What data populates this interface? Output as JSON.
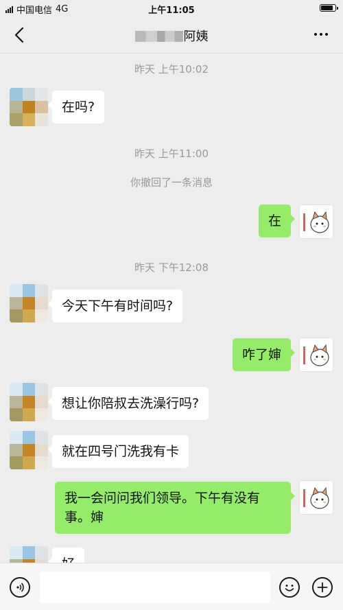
{
  "status_bar": {
    "carrier": "中国电信",
    "network": "4G",
    "time": "上午11:05",
    "battery_level": 0.85
  },
  "nav": {
    "title": "阿姨"
  },
  "messages": [
    {
      "type": "time",
      "text": "昨天 上午10:02"
    },
    {
      "type": "in",
      "text": "在吗?"
    },
    {
      "type": "time",
      "text": "昨天 上午11:00"
    },
    {
      "type": "system",
      "text": "你撤回了一条消息"
    },
    {
      "type": "out",
      "text": "在"
    },
    {
      "type": "time",
      "text": "昨天 下午12:08"
    },
    {
      "type": "in",
      "text": "今天下午有时间吗?"
    },
    {
      "type": "out",
      "text": "咋了婶"
    },
    {
      "type": "in",
      "text": "想让你陪叔去洗澡行吗?"
    },
    {
      "type": "in",
      "text": "就在四号门洗我有卡"
    },
    {
      "type": "out",
      "text": "我一会问问我们领导。下午有没有事。婶"
    },
    {
      "type": "in",
      "text": "好"
    }
  ],
  "input": {
    "placeholder": ""
  },
  "colors": {
    "background": "#ededed",
    "outgoing_bubble": "#95ec69",
    "incoming_bubble": "#ffffff",
    "meta_text": "#999999"
  },
  "icons": [
    "back-arrow-icon",
    "more-options-icon",
    "voice-icon",
    "emoji-icon",
    "add-icon"
  ]
}
